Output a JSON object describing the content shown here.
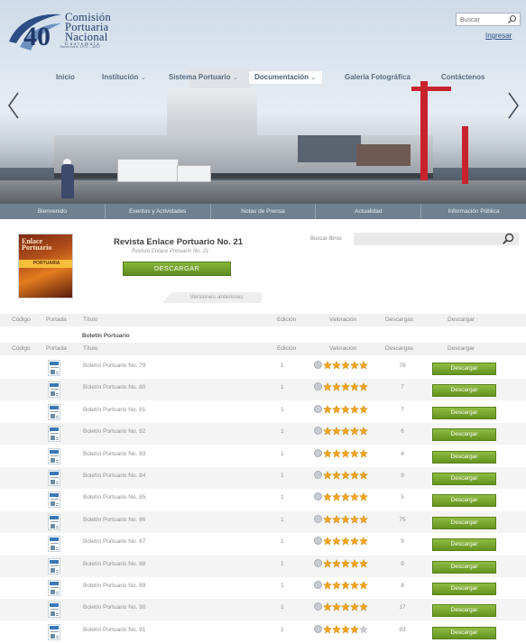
{
  "logo": {
    "line1": "Comisión",
    "line2": "Portuaria",
    "line3": "Nacional",
    "line4": "Guatemala",
    "anniversary": "Aniversario 1972 – 2012"
  },
  "header": {
    "search_placeholder": "Buscar",
    "login": "Ingresar"
  },
  "nav": {
    "items": [
      {
        "label": "Inicio"
      },
      {
        "label": "Institución",
        "caret": "⌄"
      },
      {
        "label": "Sistema Portuario",
        "caret": "⌄"
      },
      {
        "label": "Documentación",
        "caret": "⌄"
      },
      {
        "label": "Galería Fotográfica"
      },
      {
        "label": "Contáctenos"
      }
    ]
  },
  "subnav": [
    "Bienvenido",
    "Eventos y Actividades",
    "Notas de Prensa",
    "Actualidad",
    "Información Pública"
  ],
  "featured": {
    "cover_title": "Enlace Portuario",
    "cover_band": "PORTUARIA",
    "title": "Revista Enlace Portuario No. 21",
    "subtitle": "Revista Enlace Portuario No. 21",
    "download": "DESCARGAR",
    "search_books_label": "Buscar libros",
    "previous_versions": "Versiones anteriores"
  },
  "table": {
    "headers": {
      "code": "Código",
      "cover": "Portada",
      "title": "Título",
      "edition": "Edición",
      "rating": "Valoración",
      "downloads": "Descargas",
      "download": "Descargar"
    },
    "group": "Boletín Portuario",
    "download_button": "Descargar",
    "rows": [
      {
        "title": "Boletín Portuario No. 79",
        "edition": "1",
        "downloads": "76",
        "rating": 5
      },
      {
        "title": "Boletín Portuario No. 80",
        "edition": "1",
        "downloads": "7",
        "rating": 5
      },
      {
        "title": "Boletín Portuario No. 81",
        "edition": "1",
        "downloads": "7",
        "rating": 5
      },
      {
        "title": "Boletín Portuario No. 82",
        "edition": "1",
        "downloads": "6",
        "rating": 5
      },
      {
        "title": "Boletín Portuario No. 83",
        "edition": "1",
        "downloads": "4",
        "rating": 5
      },
      {
        "title": "Boletín Portuario No. 84",
        "edition": "1",
        "downloads": "9",
        "rating": 5
      },
      {
        "title": "Boletín Portuario No. 85",
        "edition": "1",
        "downloads": "5",
        "rating": 5
      },
      {
        "title": "Boletín Portuario No. 86",
        "edition": "1",
        "downloads": "75",
        "rating": 5
      },
      {
        "title": "Boletín Portuario No. 87",
        "edition": "1",
        "downloads": "9",
        "rating": 5
      },
      {
        "title": "Boletín Portuario No. 88",
        "edition": "1",
        "downloads": "9",
        "rating": 5
      },
      {
        "title": "Boletín Portuario No. 89",
        "edition": "1",
        "downloads": "8",
        "rating": 5
      },
      {
        "title": "Boletín Portuario No. 90",
        "edition": "1",
        "downloads": "17",
        "rating": 5
      },
      {
        "title": "Boletín Portuario No. 91",
        "edition": "1",
        "downloads": "83",
        "rating": 4
      }
    ]
  },
  "colors": {
    "accent_green": "#6a9a24",
    "nav_text": "#5a6b7d",
    "subnav_bg": "#6f8191",
    "star": "#f2a51a",
    "star_empty": "#c9cdd2"
  },
  "icons": {
    "search": "search-icon",
    "prev": "chevron-left-icon",
    "next": "chevron-right-icon",
    "star": "star-icon"
  }
}
